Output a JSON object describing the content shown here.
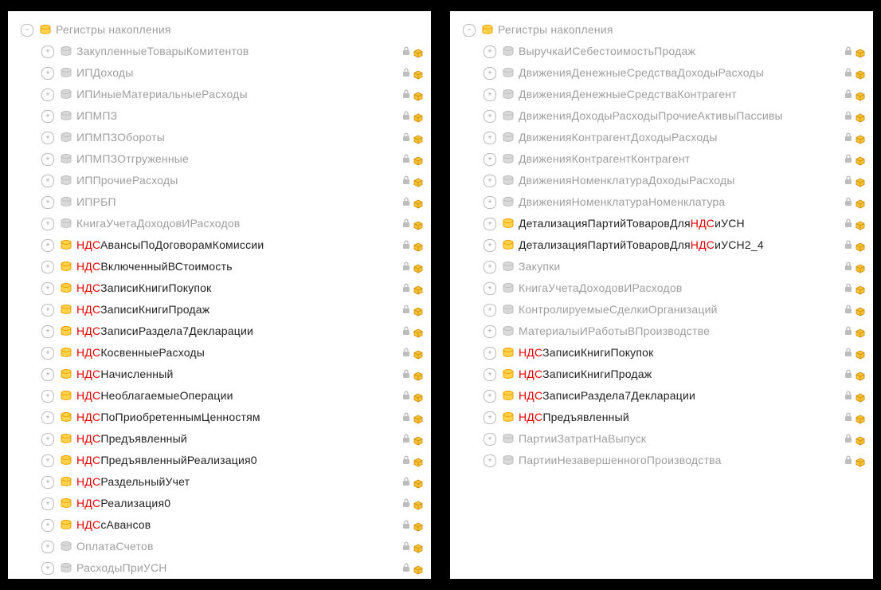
{
  "left": {
    "header": "Регистры накопления",
    "items": [
      {
        "segments": [
          {
            "t": "ЗакупленныеТоварыКомитентов",
            "c": "muted"
          }
        ],
        "muted": true
      },
      {
        "segments": [
          {
            "t": "ИПДоходы",
            "c": "muted"
          }
        ],
        "muted": true
      },
      {
        "segments": [
          {
            "t": "ИПИныеМатериальныеРасходы",
            "c": "muted"
          }
        ],
        "muted": true
      },
      {
        "segments": [
          {
            "t": "ИПМПЗ",
            "c": "muted"
          }
        ],
        "muted": true
      },
      {
        "segments": [
          {
            "t": "ИПМПЗОбороты",
            "c": "muted"
          }
        ],
        "muted": true
      },
      {
        "segments": [
          {
            "t": "ИПМПЗОтгруженные",
            "c": "muted"
          }
        ],
        "muted": true
      },
      {
        "segments": [
          {
            "t": "ИППрочиеРасходы",
            "c": "muted"
          }
        ],
        "muted": true
      },
      {
        "segments": [
          {
            "t": "ИПРБП",
            "c": "muted"
          }
        ],
        "muted": true
      },
      {
        "segments": [
          {
            "t": "КнигаУчетаДоходовИРасходов",
            "c": "muted"
          }
        ],
        "muted": true
      },
      {
        "segments": [
          {
            "t": "НДС",
            "c": "red"
          },
          {
            "t": "АвансыПоДоговорамКомиссии",
            "c": "dark"
          }
        ]
      },
      {
        "segments": [
          {
            "t": "НДС",
            "c": "red"
          },
          {
            "t": "ВключенныйВСтоимость",
            "c": "dark"
          }
        ]
      },
      {
        "segments": [
          {
            "t": "НДС",
            "c": "red"
          },
          {
            "t": "ЗаписиКнигиПокупок",
            "c": "dark"
          }
        ]
      },
      {
        "segments": [
          {
            "t": "НДС",
            "c": "red"
          },
          {
            "t": "ЗаписиКнигиПродаж",
            "c": "dark"
          }
        ]
      },
      {
        "segments": [
          {
            "t": "НДС",
            "c": "red"
          },
          {
            "t": "ЗаписиРаздела7Декларации",
            "c": "dark"
          }
        ]
      },
      {
        "segments": [
          {
            "t": "НДС",
            "c": "red"
          },
          {
            "t": "КосвенныеРасходы",
            "c": "dark"
          }
        ]
      },
      {
        "segments": [
          {
            "t": "НДС",
            "c": "red"
          },
          {
            "t": "Начисленный",
            "c": "dark"
          }
        ]
      },
      {
        "segments": [
          {
            "t": "НДС",
            "c": "red"
          },
          {
            "t": "НеоблагаемыеОперации",
            "c": "dark"
          }
        ]
      },
      {
        "segments": [
          {
            "t": "НДС",
            "c": "red"
          },
          {
            "t": "ПоПриобретеннымЦенностям",
            "c": "dark"
          }
        ]
      },
      {
        "segments": [
          {
            "t": "НДС",
            "c": "red"
          },
          {
            "t": "Предъявленный",
            "c": "dark"
          }
        ]
      },
      {
        "segments": [
          {
            "t": "НДС",
            "c": "red"
          },
          {
            "t": "ПредъявленныйРеализация0",
            "c": "dark"
          }
        ]
      },
      {
        "segments": [
          {
            "t": "НДС",
            "c": "red"
          },
          {
            "t": "РаздельныйУчет",
            "c": "dark"
          }
        ]
      },
      {
        "segments": [
          {
            "t": "НДС",
            "c": "red"
          },
          {
            "t": "Реализация0",
            "c": "dark"
          }
        ]
      },
      {
        "segments": [
          {
            "t": "НДС",
            "c": "red"
          },
          {
            "t": "сАвансов",
            "c": "dark"
          }
        ]
      },
      {
        "segments": [
          {
            "t": "ОплатаСчетов",
            "c": "muted"
          }
        ],
        "muted": true
      },
      {
        "segments": [
          {
            "t": "РасходыПриУСН",
            "c": "muted"
          }
        ],
        "muted": true
      }
    ]
  },
  "right": {
    "header": "Регистры накопления",
    "items": [
      {
        "segments": [
          {
            "t": "ВыручкаИСебестоимостьПродаж",
            "c": "muted"
          }
        ],
        "muted": true
      },
      {
        "segments": [
          {
            "t": "ДвиженияДенежныеСредстваДоходыРасходы",
            "c": "muted"
          }
        ],
        "muted": true
      },
      {
        "segments": [
          {
            "t": "ДвиженияДенежныеСредстваКонтрагент",
            "c": "muted"
          }
        ],
        "muted": true
      },
      {
        "segments": [
          {
            "t": "ДвиженияДоходыРасходыПрочиеАктивыПассивы",
            "c": "muted"
          }
        ],
        "muted": true
      },
      {
        "segments": [
          {
            "t": "ДвиженияКонтрагентДоходыРасходы",
            "c": "muted"
          }
        ],
        "muted": true
      },
      {
        "segments": [
          {
            "t": "ДвиженияКонтрагентКонтрагент",
            "c": "muted"
          }
        ],
        "muted": true
      },
      {
        "segments": [
          {
            "t": "ДвиженияНоменклатураДоходыРасходы",
            "c": "muted"
          }
        ],
        "muted": true
      },
      {
        "segments": [
          {
            "t": "ДвиженияНоменклатураНоменклатура",
            "c": "muted"
          }
        ],
        "muted": true
      },
      {
        "segments": [
          {
            "t": "ДетализацияПартийТоваровДля",
            "c": "dark"
          },
          {
            "t": "НДС",
            "c": "red"
          },
          {
            "t": "иУСН",
            "c": "dark"
          }
        ]
      },
      {
        "segments": [
          {
            "t": "ДетализацияПартийТоваровДля",
            "c": "dark"
          },
          {
            "t": "НДС",
            "c": "red"
          },
          {
            "t": "иУСН2_4",
            "c": "dark"
          }
        ]
      },
      {
        "segments": [
          {
            "t": "Закупки",
            "c": "muted"
          }
        ],
        "muted": true
      },
      {
        "segments": [
          {
            "t": "КнигаУчетаДоходовИРасходов",
            "c": "muted"
          }
        ],
        "muted": true
      },
      {
        "segments": [
          {
            "t": "КонтролируемыеСделкиОрганизаций",
            "c": "muted"
          }
        ],
        "muted": true
      },
      {
        "segments": [
          {
            "t": "МатериалыИРаботыВПроизводстве",
            "c": "muted"
          }
        ],
        "muted": true
      },
      {
        "segments": [
          {
            "t": "НДС",
            "c": "red"
          },
          {
            "t": "ЗаписиКнигиПокупок",
            "c": "dark"
          }
        ]
      },
      {
        "segments": [
          {
            "t": "НДС",
            "c": "red"
          },
          {
            "t": "ЗаписиКнигиПродаж",
            "c": "dark"
          }
        ]
      },
      {
        "segments": [
          {
            "t": "НДС",
            "c": "red"
          },
          {
            "t": "ЗаписиРаздела7Декларации",
            "c": "dark"
          }
        ]
      },
      {
        "segments": [
          {
            "t": "НДС",
            "c": "red"
          },
          {
            "t": "Предъявленный",
            "c": "dark"
          }
        ]
      },
      {
        "segments": [
          {
            "t": "ПартииЗатратНаВыпуск",
            "c": "muted"
          }
        ],
        "muted": true
      },
      {
        "segments": [
          {
            "t": "ПартииНезавершенногоПроизводства",
            "c": "muted"
          }
        ],
        "muted": true
      }
    ]
  }
}
